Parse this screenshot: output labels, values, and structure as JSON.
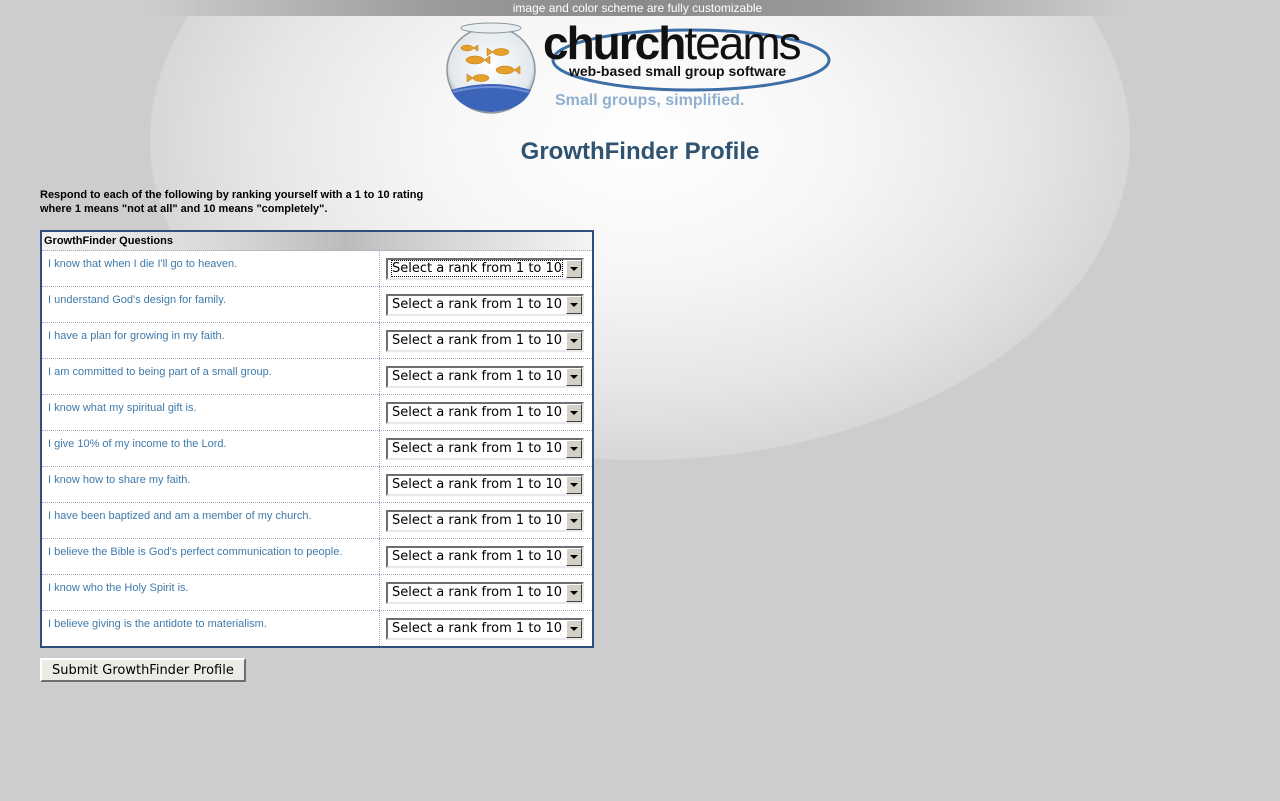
{
  "banner": {
    "text": "image and color scheme are fully customizable"
  },
  "logo": {
    "word_church": "church",
    "word_teams": "teams",
    "subtitle": "web-based small group software",
    "tagline": "Small groups, simplified."
  },
  "page": {
    "title": "GrowthFinder Profile",
    "instructions": "Respond to each of the following by ranking yourself with a 1 to 10 rating where 1 means \"not at all\" and 10 means \"completely\"."
  },
  "table": {
    "header": "GrowthFinder Questions",
    "select_placeholder": "Select a rank from 1 to 10",
    "questions": [
      "I know that when I die I'll go to heaven.",
      "I understand God's design for family.",
      "I have a plan for growing in my faith.",
      "I am committed to being part of a small group.",
      "I know what my spiritual gift is.",
      "I give 10% of my income to the Lord.",
      "I know how to share my faith.",
      "I have been baptized and am a member of my church.",
      "I believe the Bible is God's perfect communication to people.",
      "I know who the Holy Spirit is.",
      "I believe giving is the antidote to materialism."
    ]
  },
  "submit": {
    "label": "Submit GrowthFinder Profile"
  },
  "colors": {
    "background": "#cdcdcd",
    "title": "#2f5371",
    "question_text": "#3f7aaa",
    "table_border": "#2e4f7c",
    "tagline": "#8fb0cf"
  }
}
